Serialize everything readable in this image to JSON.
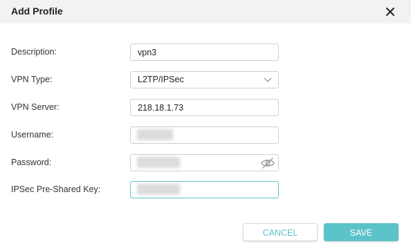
{
  "dialog": {
    "title": "Add Profile",
    "close_icon": "close-icon"
  },
  "form": {
    "description": {
      "label": "Description:",
      "value": "vpn3"
    },
    "vpn_type": {
      "label": "VPN Type:",
      "value": "L2TP/IPSec",
      "icon": "chevron-down-icon"
    },
    "vpn_server": {
      "label": "VPN Server:",
      "value": "218.18.1.73"
    },
    "username": {
      "label": "Username:",
      "value": ""
    },
    "password": {
      "label": "Password:",
      "value": "",
      "icon": "eye-off-icon"
    },
    "psk": {
      "label": "IPSec Pre-Shared Key:",
      "value": ""
    }
  },
  "actions": {
    "cancel_label": "CANCEL",
    "save_label": "SAVE"
  },
  "colors": {
    "accent": "#5bc3c9",
    "header_bg": "#f2f2f2",
    "border": "#cfcfcf"
  }
}
